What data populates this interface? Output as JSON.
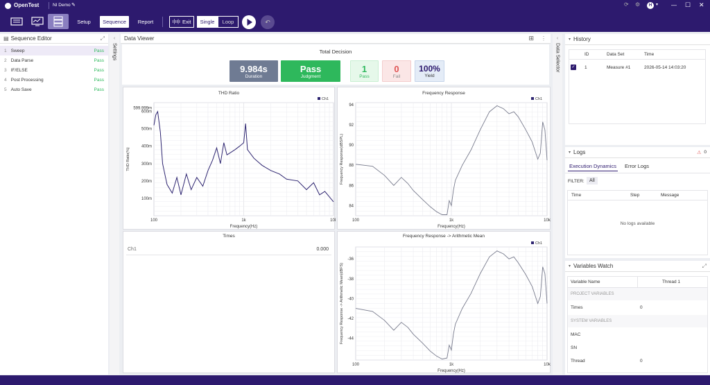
{
  "app": {
    "name": "OpenTest",
    "project": "NI Demo"
  },
  "toolbar": {
    "setup": "Setup",
    "sequence": "Sequence",
    "report": "Report",
    "exit": "Exit",
    "single": "Single",
    "loop": "Loop"
  },
  "sequence_editor": {
    "title": "Sequence Editor",
    "items": [
      {
        "num": "1",
        "name": "Sweep",
        "status": "Pass"
      },
      {
        "num": "2",
        "name": "Data Parse",
        "status": "Pass"
      },
      {
        "num": "3",
        "name": "IF/ELSE",
        "status": "Pass"
      },
      {
        "num": "4",
        "name": "Post Processing",
        "status": "Pass"
      },
      {
        "num": "5",
        "name": "Auto Save",
        "status": "Pass"
      }
    ]
  },
  "settings_tab": "Settings",
  "data_selector_tab": "Data Selector",
  "data_viewer": {
    "title": "Data Viewer",
    "total_decision": "Total Decision",
    "duration": {
      "value": "9.984s",
      "label": "Duration"
    },
    "judgment": {
      "value": "Pass",
      "label": "Judgment"
    },
    "pass": {
      "value": "1",
      "label": "Pass"
    },
    "fail": {
      "value": "0",
      "label": "Fail"
    },
    "yield": {
      "value": "100%",
      "label": "Yield"
    },
    "times_panel": {
      "title": "Times",
      "rows": [
        {
          "name": "Ch1",
          "value": "0.000"
        }
      ]
    }
  },
  "colors": {
    "brand": "#2d1a6e",
    "pass": "#2eb85c",
    "fail": "#e05555",
    "duration": "#6f7b93",
    "line": "#2d2470"
  },
  "chart_data": [
    {
      "type": "line",
      "title": "THD Ratio",
      "xlabel": "Frequency(Hz)",
      "ylabel": "THD Ratio(%)",
      "x_scale": "log",
      "xlim": [
        100,
        10000
      ],
      "ylim": [
        0,
        650
      ],
      "x_ticks": [
        "100",
        "1k",
        "10k"
      ],
      "y_ticks": [
        "100m",
        "200m",
        "300m",
        "400m",
        "500m",
        "600m",
        "599.999m"
      ],
      "legend": "top-right",
      "series": [
        {
          "name": "Ch1",
          "x": [
            100,
            105,
            110,
            118,
            125,
            140,
            160,
            180,
            200,
            230,
            260,
            300,
            350,
            400,
            450,
            500,
            550,
            600,
            650,
            700,
            800,
            900,
            1000,
            1050,
            1100,
            1300,
            1600,
            2000,
            2500,
            3000,
            4000,
            5000,
            6000,
            7000,
            8000,
            10000
          ],
          "y": [
            520,
            580,
            599,
            480,
            300,
            180,
            130,
            220,
            120,
            240,
            150,
            220,
            170,
            260,
            320,
            390,
            300,
            420,
            350,
            360,
            380,
            400,
            420,
            530,
            380,
            330,
            290,
            260,
            240,
            210,
            200,
            150,
            190,
            120,
            140,
            80
          ]
        }
      ]
    },
    {
      "type": "line",
      "title": "Frequency Response",
      "xlabel": "Frequency(Hz)",
      "ylabel": "Frequency Response(dBSPL)",
      "x_scale": "log",
      "xlim": [
        100,
        10000
      ],
      "ylim": [
        83,
        94.2
      ],
      "x_ticks": [
        "100",
        "1k",
        "10k"
      ],
      "y_ticks": [
        "84",
        "86",
        "88",
        "90",
        "92",
        "94"
      ],
      "legend": "top-right",
      "series": [
        {
          "name": "Ch1",
          "x": [
            100,
            150,
            200,
            250,
            300,
            350,
            400,
            500,
            600,
            700,
            800,
            900,
            950,
            1000,
            1050,
            1100,
            1300,
            1600,
            2000,
            2500,
            3000,
            3500,
            4000,
            4500,
            5000,
            6000,
            7000,
            8000,
            8500,
            9000,
            9500,
            10000
          ],
          "y": [
            88.1,
            87.9,
            87.0,
            86.0,
            86.8,
            86.2,
            85.5,
            84.6,
            83.9,
            83.4,
            83.1,
            83.1,
            84.5,
            84.0,
            85.5,
            86.5,
            88.0,
            89.5,
            91.5,
            93.3,
            93.9,
            93.6,
            93.1,
            93.3,
            92.8,
            91.5,
            90.3,
            88.6,
            89.2,
            92.3,
            91.5,
            88.5
          ]
        }
      ]
    },
    {
      "type": "line",
      "title": "Frequency Response -> Arithmetic Mean",
      "xlabel": "Frequency(Hz)",
      "ylabel": "Frequency Response -> Arithmetic Mean(dBFS)",
      "x_scale": "log",
      "xlim": [
        100,
        10000
      ],
      "ylim": [
        -46.2,
        -34.8
      ],
      "x_ticks": [
        "100",
        "1k",
        "10k"
      ],
      "y_ticks": [
        "-44",
        "-42",
        "-40",
        "-38",
        "-36"
      ],
      "legend": "top-right",
      "series": [
        {
          "name": "Ch1",
          "x": [
            100,
            150,
            200,
            250,
            300,
            350,
            400,
            500,
            600,
            700,
            800,
            900,
            950,
            1000,
            1050,
            1100,
            1300,
            1600,
            2000,
            2500,
            3000,
            3500,
            4000,
            4500,
            5000,
            6000,
            7000,
            8000,
            8500,
            9000,
            9500,
            10000
          ],
          "y": [
            -41.0,
            -41.3,
            -42.2,
            -43.2,
            -42.4,
            -42.9,
            -43.6,
            -44.5,
            -45.3,
            -45.8,
            -46.1,
            -46.0,
            -44.7,
            -45.2,
            -43.6,
            -42.6,
            -41.0,
            -39.5,
            -37.5,
            -35.8,
            -35.2,
            -35.5,
            -36.0,
            -35.8,
            -36.4,
            -37.6,
            -38.8,
            -40.5,
            -39.8,
            -36.8,
            -37.5,
            -40.5
          ]
        }
      ]
    }
  ],
  "history": {
    "title": "History",
    "columns": [
      "ID",
      "Data Set",
      "Time"
    ],
    "rows": [
      {
        "id": "1",
        "dataset": "Measure #1",
        "time": "2026-05-14 14:03:20"
      }
    ]
  },
  "logs": {
    "title": "Logs",
    "error_count": "0",
    "tabs": [
      "Execution Dynamics",
      "Error Logs"
    ],
    "filter_label": "FILTER:",
    "filter_value": "All",
    "columns": [
      "Time",
      "Step",
      "Message"
    ],
    "empty": "No logs available"
  },
  "variables_watch": {
    "title": "Variables Watch",
    "col_name": "Variable Name",
    "col_thread": "Thread 1",
    "project_section": "PROJECT VARIABLES",
    "project_vars": [
      {
        "name": "Times",
        "value": "0"
      }
    ],
    "system_section": "SYSTEM VARIABLES",
    "system_vars": [
      {
        "name": "MAC",
        "value": ""
      },
      {
        "name": "SN",
        "value": ""
      },
      {
        "name": "Thread",
        "value": "0"
      }
    ]
  }
}
